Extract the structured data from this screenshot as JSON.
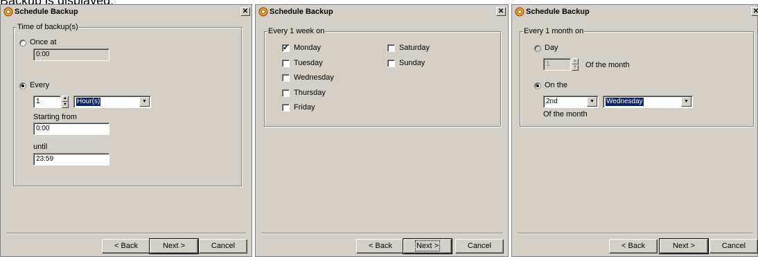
{
  "caption": "Backup is displayed:",
  "dialogs": [
    {
      "title": "Schedule Backup",
      "group_label": "Time of backup(s)",
      "once_at_label": "Once at",
      "once_at_value": "0:00",
      "every_label": "Every",
      "every_value": "1",
      "every_unit": "Hour(s)",
      "starting_from_label": "Starting from",
      "starting_from_value": "0:00",
      "until_label": "until",
      "until_value": "23:59",
      "selected_option": "Every",
      "buttons": {
        "back": "< Back",
        "next": "Next >",
        "cancel": "Cancel"
      }
    },
    {
      "title": "Schedule Backup",
      "group_label": "Every 1 week on",
      "days": [
        {
          "label": "Monday",
          "checked": true
        },
        {
          "label": "Tuesday",
          "checked": false
        },
        {
          "label": "Wednesday",
          "checked": false
        },
        {
          "label": "Thursday",
          "checked": false
        },
        {
          "label": "Friday",
          "checked": false
        },
        {
          "label": "Saturday",
          "checked": false
        },
        {
          "label": "Sunday",
          "checked": false
        }
      ],
      "buttons": {
        "back": "< Back",
        "next": "Next >",
        "cancel": "Cancel"
      }
    },
    {
      "title": "Schedule Backup",
      "group_label": "Every 1 month on",
      "day_label": "Day",
      "day_value": "1",
      "of_the_month_label": "Of the month",
      "on_the_label": "On the",
      "ordinal_value": "2nd",
      "weekday_value": "Wednesday",
      "of_the_month_label_2": "Of the month",
      "selected_option": "On the",
      "buttons": {
        "back": "< Back",
        "next": "Next >",
        "cancel": "Cancel"
      }
    }
  ]
}
